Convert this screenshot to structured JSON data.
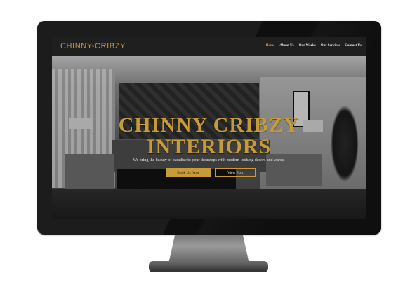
{
  "brand": {
    "logo_text": "CHINNY-CRIBZY",
    "accent_color": "#c79a3a"
  },
  "nav": {
    "items": [
      "Home",
      "About Us",
      "Our Works",
      "Our Services",
      "Contact Us"
    ],
    "active": "Home"
  },
  "hero": {
    "title_line1": "CHINNY CRIBZY",
    "title_line2": "INTERIORS",
    "tagline": "We bring the beauty of paradise to your doorsteps with modern-looking decors and wares.",
    "primary_button": "Book Us Now",
    "secondary_button": "View Port"
  }
}
